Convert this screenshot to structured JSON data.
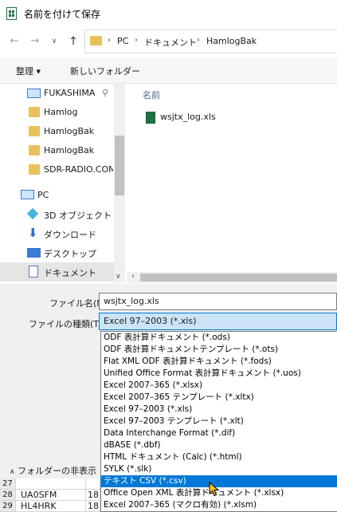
{
  "title": "名前を付けて保存",
  "nav": {
    "back_icon": "arrow-left-icon",
    "forward_icon": "arrow-right-icon",
    "recent_icon": "chevron-down-icon",
    "up_icon": "arrow-up-icon",
    "breadcrumb": [
      "PC",
      "ドキュメント",
      "HamlogBak"
    ]
  },
  "toolbar": {
    "organize": "整理 ▾",
    "new_folder": "新しいフォルダー"
  },
  "sidebar": {
    "items": [
      {
        "label": "FUKASHIMA",
        "icon": "desktop-icon"
      },
      {
        "label": "Hamlog",
        "icon": "folder-icon"
      },
      {
        "label": "HamlogBak",
        "icon": "folder-icon"
      },
      {
        "label": "HamlogBak",
        "icon": "folder-icon"
      },
      {
        "label": "SDR-RADIO.COM",
        "icon": "folder-icon"
      },
      {
        "label": "PC",
        "icon": "pc-icon"
      },
      {
        "label": "3D オブジェクト",
        "icon": "3d-objects-icon"
      },
      {
        "label": "ダウンロード",
        "icon": "download-icon"
      },
      {
        "label": "デスクトップ",
        "icon": "desktop-icon"
      },
      {
        "label": "ドキュメント",
        "icon": "documents-icon"
      }
    ]
  },
  "filelist": {
    "column_name": "名前",
    "files": [
      {
        "name": "wsjtx_log.xls",
        "icon": "excel-file-icon"
      }
    ]
  },
  "form": {
    "filename_label": "ファイル名(N):",
    "filename_value": "wsjtx_log.xls",
    "filetype_label": "ファイルの種類(T):",
    "filetype_value": "Excel 97–2003 (*.xls)",
    "hide_folders": "フォルダーの非表示"
  },
  "filetype_options": [
    "ODF 表計算ドキュメント (*.ods)",
    "ODF 表計算ドキュメントテンプレート (*.ots)",
    "Flat XML ODF 表計算ドキュメント (*.fods)",
    "Unified Office Format 表計算ドキュメント (*.uos)",
    "Excel 2007–365 (*.xlsx)",
    "Excel 2007–365 テンプレート (*.xltx)",
    "Excel 97–2003 (*.xls)",
    "Excel 97–2003 テンプレート (*.xlt)",
    "Data Interchange Format (*.dif)",
    "dBASE (*.dbf)",
    "HTML ドキュメント (Calc) (*.html)",
    "SYLK (*.slk)",
    "テキスト CSV (*.csv)",
    "Office Open XML 表計算ドキュメント (*.xlsx)",
    "Excel 2007–365 (マクロ有効) (*.xlsm)"
  ],
  "selected_option": "テキスト CSV (*.csv)",
  "sheet": {
    "rows": [
      {
        "num": "27",
        "a": "",
        "b": ""
      },
      {
        "num": "28",
        "a": "UA0SFM",
        "b": "18"
      },
      {
        "num": "29",
        "a": "HL4HRK",
        "b": "18"
      }
    ]
  },
  "colors": {
    "accent": "#0078d7",
    "folder": "#e9c15b",
    "excel": "#1e7145"
  }
}
